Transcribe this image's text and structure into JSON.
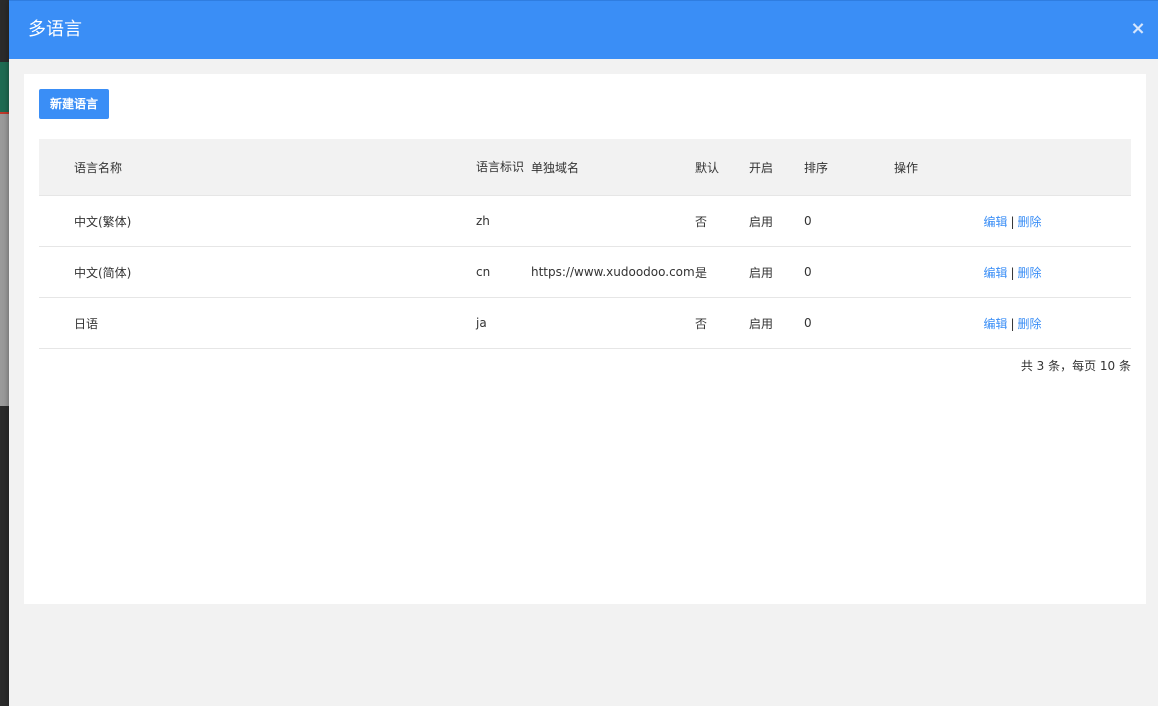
{
  "modal": {
    "title": "多语言",
    "close_label": "×"
  },
  "toolbar": {
    "new_label": "新建语言"
  },
  "table": {
    "columns": {
      "name": "语言名称",
      "code": "语言标识",
      "domain": "单独域名",
      "default": "默认",
      "enabled": "开启",
      "sort": "排序",
      "actions": "操作"
    },
    "rows": [
      {
        "name": "中文(繁体)",
        "code": "zh",
        "domain": "",
        "default": "否",
        "enabled": "启用",
        "sort": "0",
        "edit": "编辑",
        "sep": "|",
        "delete": "删除"
      },
      {
        "name": "中文(简体)",
        "code": "cn",
        "domain": "https://www.xudoodoo.com",
        "default": "是",
        "enabled": "启用",
        "sort": "0",
        "edit": "编辑",
        "sep": "|",
        "delete": "删除"
      },
      {
        "name": "日语",
        "code": "ja",
        "domain": "",
        "default": "否",
        "enabled": "启用",
        "sort": "0",
        "edit": "编辑",
        "sep": "|",
        "delete": "删除"
      }
    ]
  },
  "pagination": {
    "summary": "共 3 条，每页 10 条"
  },
  "colors": {
    "primary": "#3a8ef6",
    "header_bg": "#f2f2f2",
    "text": "#333333"
  }
}
